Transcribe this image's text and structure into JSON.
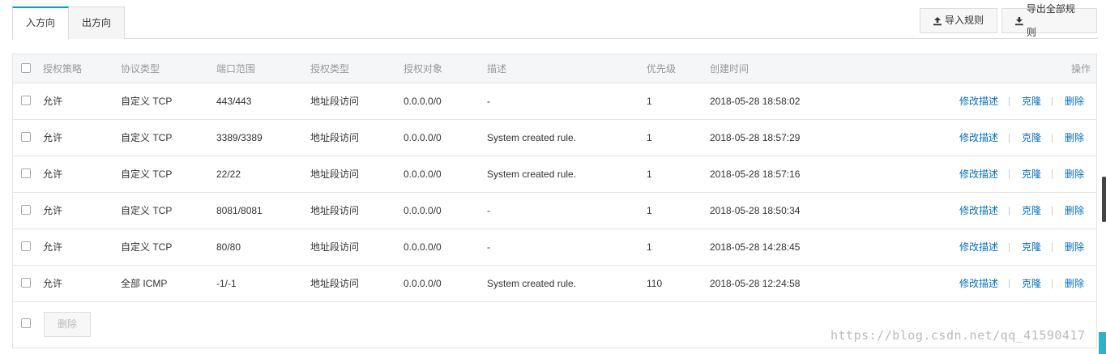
{
  "tabs": [
    {
      "label": "入方向",
      "active": true
    },
    {
      "label": "出方向",
      "active": false
    }
  ],
  "toolbar": {
    "import_label": "导入规则",
    "export_label": "导出全部规则"
  },
  "table": {
    "headers": {
      "policy": "授权策略",
      "protocol": "协议类型",
      "port": "端口范围",
      "auth_type": "授权类型",
      "auth_object": "授权对象",
      "description": "描述",
      "priority": "优先级",
      "created": "创建时间",
      "actions": "操作"
    },
    "rows": [
      {
        "policy": "允许",
        "protocol": "自定义 TCP",
        "port": "443/443",
        "auth_type": "地址段访问",
        "auth_object": "0.0.0.0/0",
        "description": "-",
        "priority": "1",
        "created": "2018-05-28 18:58:02"
      },
      {
        "policy": "允许",
        "protocol": "自定义 TCP",
        "port": "3389/3389",
        "auth_type": "地址段访问",
        "auth_object": "0.0.0.0/0",
        "description": "System created rule.",
        "priority": "1",
        "created": "2018-05-28 18:57:29"
      },
      {
        "policy": "允许",
        "protocol": "自定义 TCP",
        "port": "22/22",
        "auth_type": "地址段访问",
        "auth_object": "0.0.0.0/0",
        "description": "System created rule.",
        "priority": "1",
        "created": "2018-05-28 18:57:16"
      },
      {
        "policy": "允许",
        "protocol": "自定义 TCP",
        "port": "8081/8081",
        "auth_type": "地址段访问",
        "auth_object": "0.0.0.0/0",
        "description": "-",
        "priority": "1",
        "created": "2018-05-28 18:50:34"
      },
      {
        "policy": "允许",
        "protocol": "自定义 TCP",
        "port": "80/80",
        "auth_type": "地址段访问",
        "auth_object": "0.0.0.0/0",
        "description": "-",
        "priority": "1",
        "created": "2018-05-28 14:28:45"
      },
      {
        "policy": "允许",
        "protocol": "全部 ICMP",
        "port": "-1/-1",
        "auth_type": "地址段访问",
        "auth_object": "0.0.0.0/0",
        "description": "System created rule.",
        "priority": "110",
        "created": "2018-05-28 12:24:58"
      }
    ],
    "row_actions": {
      "edit": "修改描述",
      "clone": "克隆",
      "delete": "删除"
    }
  },
  "footer": {
    "delete_label": "删除"
  },
  "watermark": "https://blog.csdn.net/qq_41590417",
  "colors": {
    "accent": "#00a2ca",
    "link": "#0070cc",
    "header_bg": "#f5f6f7"
  }
}
